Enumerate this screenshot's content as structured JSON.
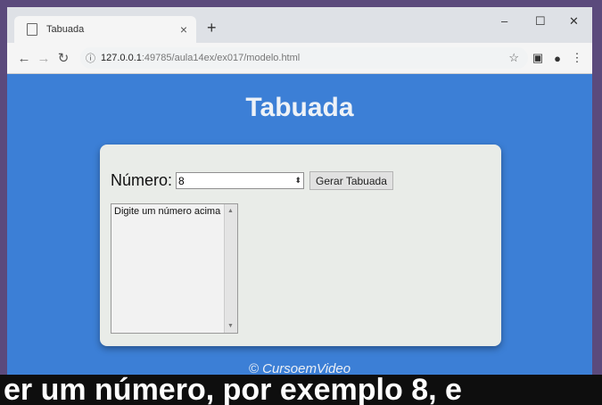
{
  "browser": {
    "tab_title": "Tabuada",
    "new_tab": "+",
    "close_tab": "×",
    "minimize": "–",
    "maximize": "☐",
    "close_window": "✕",
    "url_host": "127.0.0.1",
    "url_path": ":49785/aula14ex/ex017/modelo.html",
    "icons": [
      "back-icon",
      "forward-icon",
      "reload-icon",
      "info-icon",
      "star-icon",
      "extension-icon",
      "profile-icon",
      "menu-icon"
    ]
  },
  "page": {
    "title": "Tabuada",
    "numero_label": "Número:",
    "numero_value": "8",
    "gerar_label": "Gerar Tabuada",
    "list_items": [
      "Digite um número acima"
    ],
    "footer": "© CursoemVideo"
  },
  "caption": "er um número, por exemplo 8, e"
}
